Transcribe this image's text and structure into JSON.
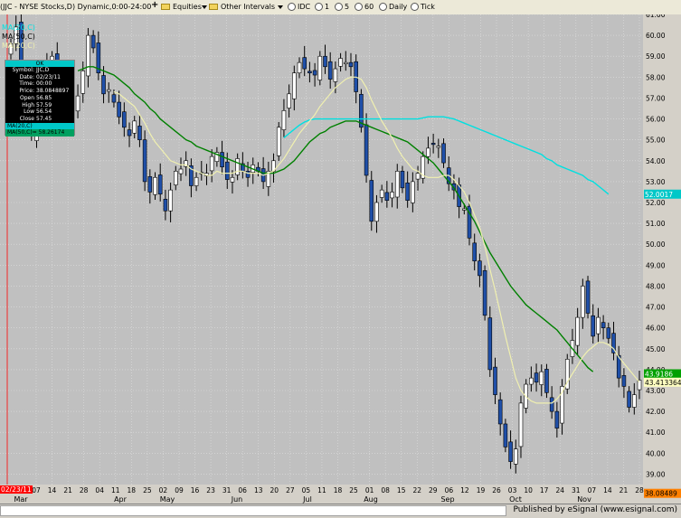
{
  "toolbar": {
    "symbol_title": "(JJC - NYSE Stocks,D) Dynamic,0:00-24:00",
    "equities_label": "Equities",
    "other_intervals_label": "Other Intervals",
    "intervals": [
      "IDC",
      "1",
      "5",
      "60",
      "Daily",
      "Tick"
    ]
  },
  "indicators": {
    "ma20_label": "MA(20,C)",
    "ma50_label": "MA(50,C)",
    "ma_legend_faint": "MA(20,C)"
  },
  "data_window": {
    "header": "OK",
    "rows": [
      {
        "k": "Symbol:",
        "v": "JJC,D"
      },
      {
        "k": "Date:",
        "v": "02/23/11"
      },
      {
        "k": "Time:",
        "v": "00:00"
      },
      {
        "k": "Price:",
        "v": "38.0848897"
      },
      {
        "k": "Open",
        "v": "56.85"
      },
      {
        "k": "High",
        "v": "57.59"
      },
      {
        "k": "Low",
        "v": "56.54"
      },
      {
        "k": "Close",
        "v": "57.45"
      }
    ],
    "ma20_row": "MA(20,C)",
    "ma50_row": "MA(50,C)= 58.26174"
  },
  "price_tags": [
    {
      "text": "52.0017",
      "price": 52.4,
      "color": "#00c8c8",
      "fg": "#ffffff"
    },
    {
      "text": "43.9186",
      "price": 43.8,
      "color": "#00a000",
      "fg": "#ffffff"
    },
    {
      "text": "43.413364",
      "price": 43.4,
      "color": "#ffffc0",
      "fg": "#000000"
    },
    {
      "text": "38.08489",
      "price": 38.08,
      "color": "#ff8000",
      "fg": "#000000"
    }
  ],
  "cursor_date": "02/23/11",
  "footer": {
    "published": "Published by eSignal (www.esignal.com)"
  },
  "colors": {
    "bg": "#c0c0c0",
    "grid": "#e0e0e0",
    "up": "#ffffff",
    "down": "#1f4fa8",
    "wick": "#000000",
    "ma20": "#f0f0b0",
    "ma50": "#008000",
    "ma200": "#00e0e0",
    "cursor": "#ff0000"
  },
  "chart_data": {
    "type": "candlestick",
    "ylim": [
      38.5,
      61.0
    ],
    "y_ticks": [
      39.0,
      40.0,
      41.0,
      42.0,
      43.0,
      44.0,
      45.0,
      46.0,
      47.0,
      48.0,
      49.0,
      50.0,
      51.0,
      52.0,
      53.0,
      54.0,
      55.0,
      56.0,
      57.0,
      58.0,
      59.0,
      60.0,
      61.0
    ],
    "x_day_labels": [
      "07",
      "14",
      "21",
      "28",
      "04",
      "11",
      "18",
      "25",
      "02",
      "09",
      "16",
      "23",
      "31",
      "06",
      "13",
      "20",
      "27",
      "05",
      "11",
      "18",
      "25",
      "01",
      "08",
      "15",
      "22",
      "29",
      "06",
      "12",
      "19",
      "26",
      "03",
      "10",
      "17",
      "24",
      "31",
      "07",
      "14",
      "21",
      "28"
    ],
    "x_month_labels": [
      "Mar",
      "Apr",
      "May",
      "Jun",
      "Jul",
      "Aug",
      "Sep",
      "Oct",
      "Nov"
    ],
    "closes": [
      59.6,
      60.4,
      58.4,
      56.6,
      55.2,
      56.0,
      58.2,
      58.8,
      59.0,
      58.2,
      57.2,
      56.9,
      56.5,
      57.1,
      58.3,
      60.0,
      59.4,
      58.2,
      57.2,
      57.4,
      56.8,
      56.1,
      55.6,
      55.2,
      55.9,
      55.0,
      53.0,
      52.5,
      53.2,
      52.4,
      51.6,
      52.6,
      53.5,
      53.6,
      54.0,
      52.8,
      53.2,
      53.4,
      53.4,
      54.2,
      54.4,
      53.7,
      53.1,
      53.2,
      54.1,
      53.5,
      53.2,
      53.8,
      53.5,
      53.0,
      53.5,
      54.0,
      55.6,
      56.4,
      57.2,
      58.2,
      58.7,
      58.4,
      58.2,
      58.1,
      59.0,
      58.5,
      57.9,
      58.4,
      58.9,
      58.7,
      58.5,
      57.3,
      55.6,
      53.3,
      51.1,
      52.0,
      52.6,
      52.1,
      52.5,
      53.5,
      52.7,
      52.1,
      53.0,
      53.4,
      54.2,
      54.6,
      54.8,
      54.7,
      53.9,
      52.9,
      52.6,
      51.8,
      51.7,
      50.3,
      49.2,
      48.5,
      46.6,
      44.0,
      42.8,
      41.4,
      40.3,
      39.6,
      40.2,
      42.4,
      43.3,
      43.6,
      43.4,
      43.9,
      42.9,
      42.0,
      41.2,
      43.2,
      44.5,
      45.4,
      46.5,
      48.0,
      46.7,
      45.6,
      46.5,
      46.0,
      45.5,
      44.8,
      43.6,
      43.2,
      42.2,
      42.8,
      43.5
    ],
    "ma20": [
      null,
      null,
      null,
      null,
      null,
      null,
      null,
      null,
      null,
      null,
      null,
      null,
      null,
      null,
      null,
      null,
      null,
      null,
      null,
      null,
      57.3,
      57.2,
      57.0,
      56.8,
      56.6,
      56.2,
      55.8,
      55.3,
      54.9,
      54.6,
      54.3,
      54.0,
      53.9,
      53.8,
      53.8,
      53.6,
      53.5,
      53.4,
      53.3,
      53.3,
      53.5,
      53.4,
      53.4,
      53.4,
      53.5,
      53.5,
      53.4,
      53.4,
      53.4,
      53.3,
      53.4,
      53.5,
      53.8,
      54.1,
      54.5,
      54.9,
      55.3,
      55.6,
      55.9,
      56.2,
      56.6,
      56.9,
      57.2,
      57.5,
      57.7,
      57.9,
      58.0,
      58.0,
      57.9,
      57.5,
      56.9,
      56.4,
      55.9,
      55.5,
      55.1,
      54.6,
      54.2,
      53.9,
      53.6,
      53.5,
      53.3,
      53.2,
      53.2,
      53.2,
      53.3,
      53.3,
      53.1,
      52.8,
      52.5,
      52.0,
      51.4,
      50.8,
      49.9,
      48.8,
      47.8,
      46.7,
      45.6,
      44.6,
      43.6,
      43.0,
      42.7,
      42.5,
      42.4,
      42.4,
      42.4,
      42.4,
      42.6,
      42.9,
      43.4,
      43.8,
      44.2,
      44.6,
      44.9,
      45.1,
      45.3,
      45.3,
      45.2,
      45.0,
      44.6,
      44.3,
      44.0,
      43.7,
      43.4
    ],
    "ma50": [
      null,
      null,
      null,
      null,
      null,
      null,
      null,
      null,
      null,
      null,
      null,
      null,
      null,
      58.3,
      58.4,
      58.5,
      58.5,
      58.4,
      58.3,
      58.2,
      58.1,
      57.9,
      57.7,
      57.5,
      57.2,
      57.0,
      56.8,
      56.5,
      56.3,
      56.0,
      55.8,
      55.6,
      55.4,
      55.2,
      55.0,
      54.9,
      54.7,
      54.6,
      54.5,
      54.4,
      54.3,
      54.2,
      54.1,
      54.0,
      53.9,
      53.8,
      53.7,
      53.6,
      53.5,
      53.4,
      53.4,
      53.4,
      53.5,
      53.6,
      53.8,
      54.0,
      54.3,
      54.6,
      54.9,
      55.1,
      55.3,
      55.4,
      55.6,
      55.7,
      55.8,
      55.9,
      55.9,
      55.9,
      55.8,
      55.7,
      55.6,
      55.5,
      55.4,
      55.3,
      55.2,
      55.1,
      55.0,
      54.9,
      54.7,
      54.5,
      54.3,
      54.1,
      53.9,
      53.6,
      53.3,
      53.0,
      52.7,
      52.3,
      51.9,
      51.5,
      51.1,
      50.6,
      50.1,
      49.6,
      49.2,
      48.8,
      48.4,
      48.0,
      47.7,
      47.4,
      47.1,
      46.9,
      46.7,
      46.5,
      46.3,
      46.1,
      45.9,
      45.6,
      45.3,
      45.0,
      44.7,
      44.4,
      44.1,
      43.9
    ],
    "ma200": {
      "x_index_start": 53,
      "values": [
        55.1,
        55.3,
        55.5,
        55.7,
        55.85,
        55.95,
        56.0,
        56.0,
        56.0,
        56.0,
        56.0,
        56.0,
        56.0,
        56.0,
        56.0,
        56.0,
        56.0,
        56.0,
        56.0,
        56.0,
        56.0,
        56.0,
        56.0,
        56.0,
        56.0,
        56.0,
        56.0,
        56.05,
        56.1,
        56.1,
        56.1,
        56.1,
        56.05,
        56.0,
        55.9,
        55.8,
        55.7,
        55.6,
        55.5,
        55.4,
        55.3,
        55.2,
        55.1,
        55.0,
        54.9,
        54.8,
        54.7,
        54.6,
        54.5,
        54.4,
        54.3,
        54.1,
        54.0,
        53.8,
        53.7,
        53.6,
        53.5,
        53.4,
        53.3,
        53.1,
        53.0,
        52.8,
        52.6,
        52.4
      ]
    }
  }
}
